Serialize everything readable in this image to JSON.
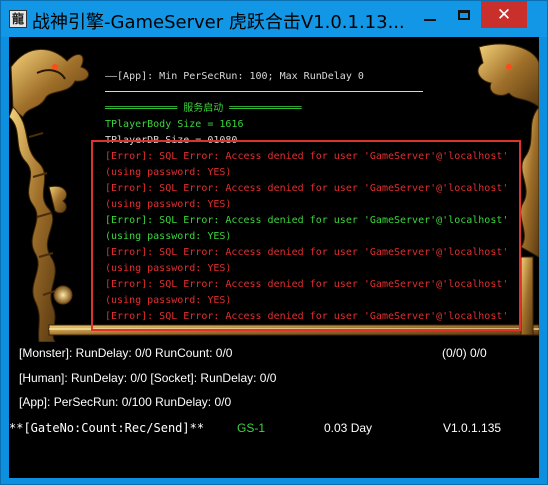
{
  "window": {
    "title": "战神引擎-GameServer 虎跃合击V1.0.1.13...",
    "icon_name": "app-icon",
    "icon_glyph": "龍",
    "minimize_icon": "minimize-icon",
    "maximize_icon": "maximize-icon",
    "close_icon": "close-icon",
    "close_glyph": "✕"
  },
  "log": {
    "header": "——[App]: Min PerSecRun: 100; Max RunDelay 0",
    "startup_banner": "════════════ 服务启动 ════════════",
    "player_body_size": "TPlayerBody Size = 1616",
    "player_db_size": "TPlayerDB Size = 01080",
    "errors": [
      {
        "line1": "[Error]: SQL Error: Access denied for user 'GameServer'@'localhost'",
        "line2": "(using password: YES)",
        "color": "red"
      },
      {
        "line1": "[Error]: SQL Error: Access denied for user 'GameServer'@'localhost'",
        "line2": "(using password: YES)",
        "color": "red"
      },
      {
        "line1": "[Error]: SQL Error: Access denied for user 'GameServer'@'localhost'",
        "line2": "(using password: YES)",
        "color": "green"
      },
      {
        "line1": "[Error]: SQL Error: Access denied for user 'GameServer'@'localhost'",
        "line2": "(using password: YES)",
        "color": "red"
      },
      {
        "line1": "[Error]: SQL Error: Access denied for user 'GameServer'@'localhost'",
        "line2": "(using password: YES)",
        "color": "red"
      },
      {
        "line1": "[Error]: SQL Error: Access denied for user 'GameServer'@'localhost'",
        "line2": "",
        "color": "red"
      }
    ]
  },
  "stats": {
    "monster": "[Monster]: RunDelay: 0/0  RunCount: 0/0",
    "monster_right": "(0/0) 0/0",
    "human": "[Human]: RunDelay: 0/0  [Socket]: RunDelay: 0/0",
    "app": "[App]: PerSecRun: 0/100  RunDelay: 0/0",
    "gate": "**[GateNo:Count:Rec/Send]**",
    "server_name": "GS-1",
    "uptime": "0.03 Day",
    "version": "V1.0.1.135"
  },
  "colors": {
    "titlebar": "#1296e6",
    "log_green": "#3bd63b",
    "log_red": "#e22e2e",
    "highlight_box": "#e0322d",
    "close_button": "#c9302c"
  }
}
